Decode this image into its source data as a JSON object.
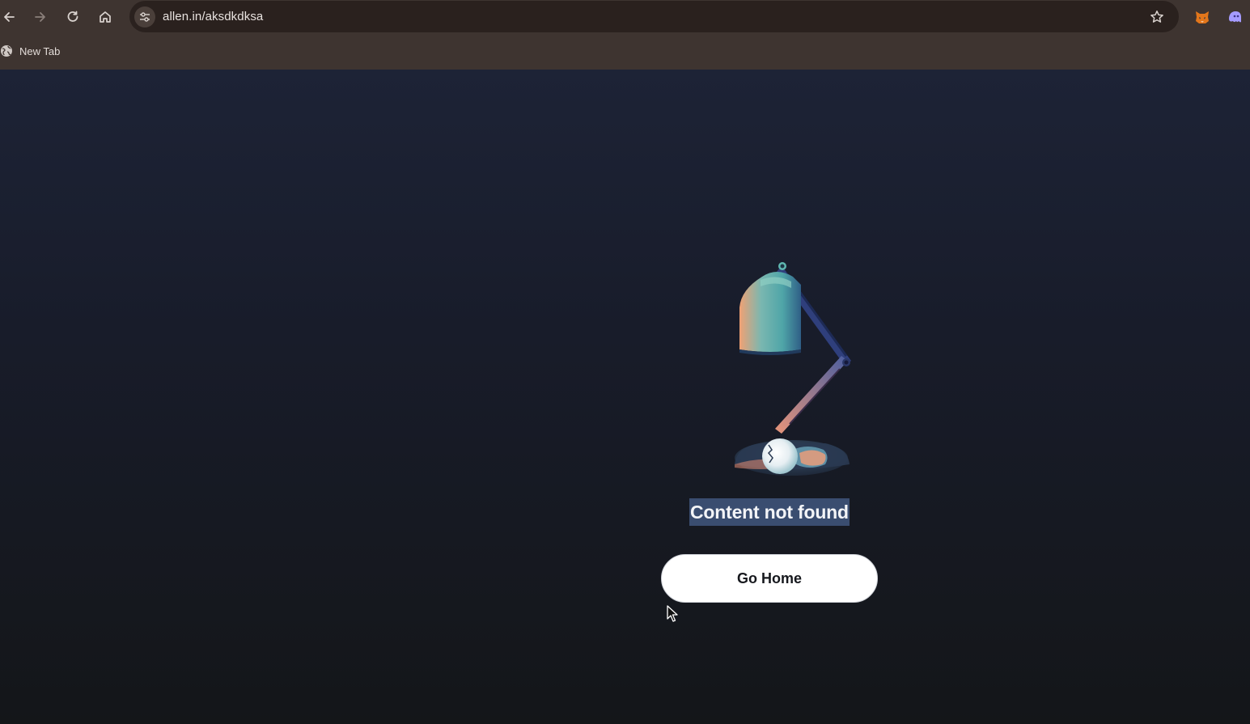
{
  "browser": {
    "url": "allen.in/aksdkdksa",
    "bookmarks": [
      {
        "label": "New Tab",
        "icon": "globe-icon"
      }
    ],
    "icons": {
      "back": "back-arrow-icon",
      "forward": "forward-arrow-icon",
      "reload": "reload-icon",
      "home": "home-icon",
      "site_info": "site-settings-icon",
      "bookmark": "star-icon",
      "extensions": [
        "fox-extension-icon",
        "ghost-extension-icon"
      ]
    }
  },
  "page": {
    "illustration": "desk-lamp-broken-bulb",
    "message": "Content not found",
    "button_label": "Go Home"
  },
  "colors": {
    "browser_chrome": "#3e3430",
    "omnibox": "#2a211e",
    "page_top": "#1d2336",
    "page_bottom": "#141619",
    "text_selection": "#3a4d70",
    "button_bg": "#ffffff"
  }
}
